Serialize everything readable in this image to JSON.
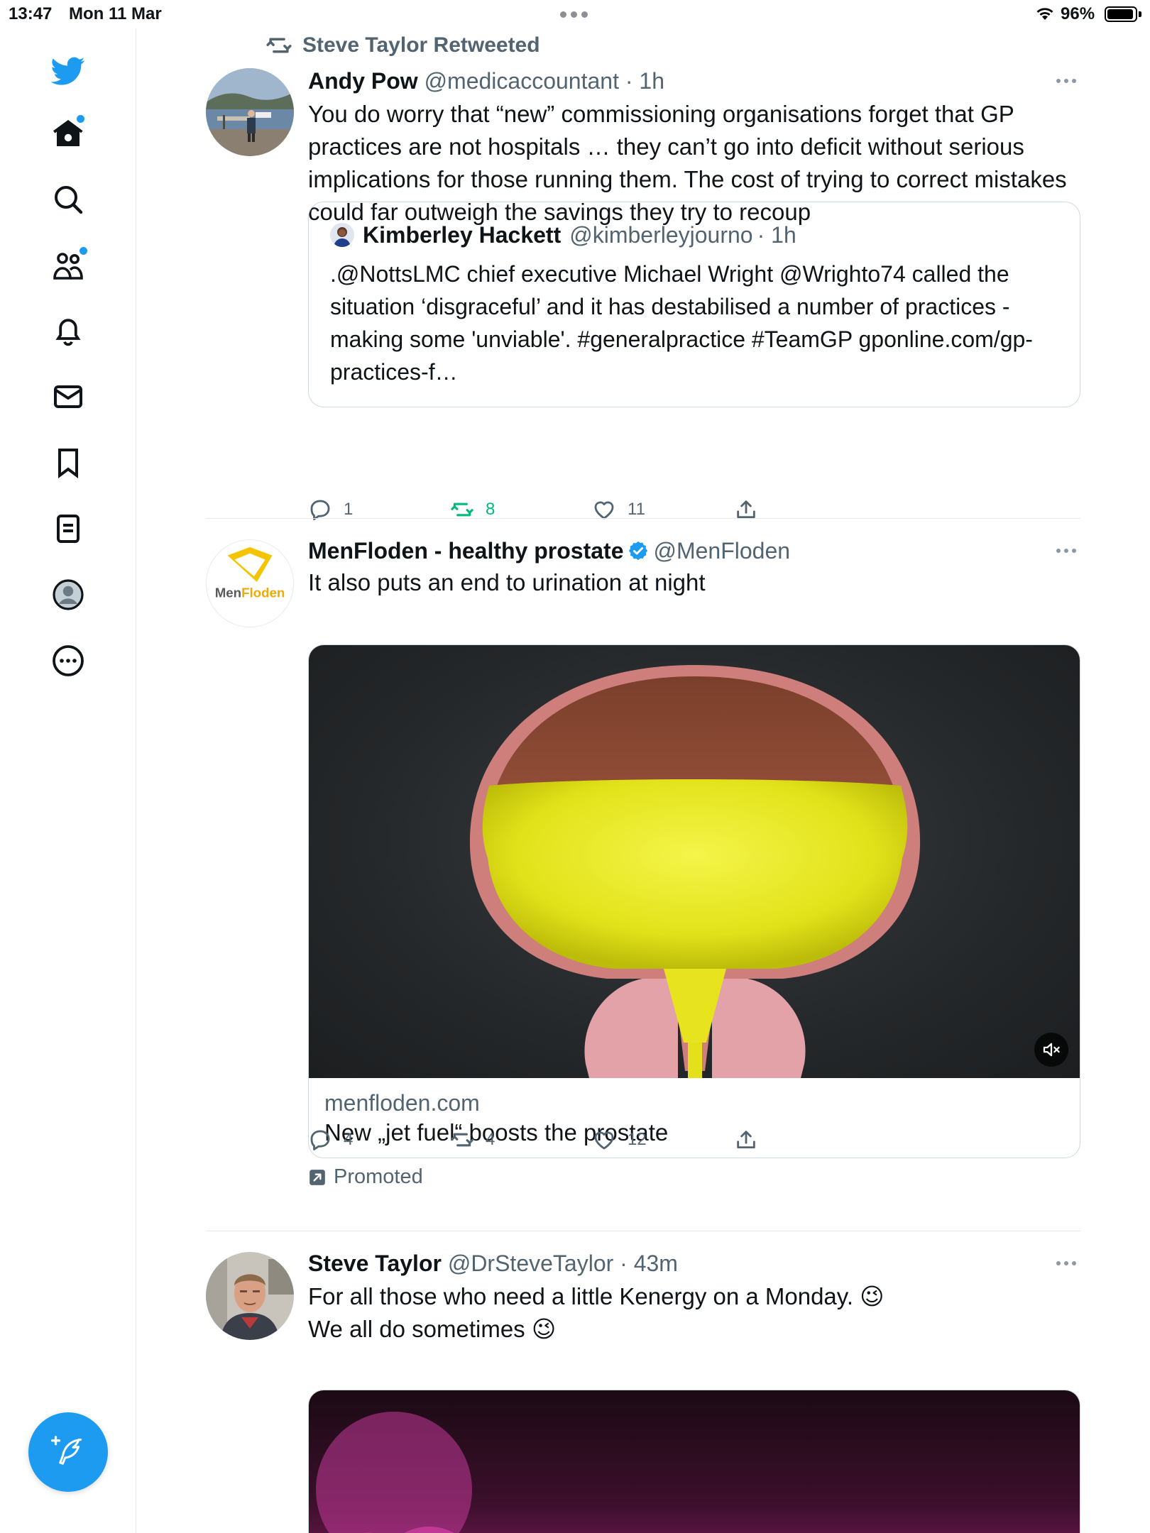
{
  "status_bar": {
    "time": "13:47",
    "date": "Mon 11 Mar",
    "battery_percent": "96%",
    "battery_level": 0.96
  },
  "sidebar": {
    "items": [
      {
        "name": "twitter-logo-icon"
      },
      {
        "name": "home-icon",
        "has_dot": true
      },
      {
        "name": "search-icon"
      },
      {
        "name": "communities-icon",
        "has_dot": true
      },
      {
        "name": "notifications-icon"
      },
      {
        "name": "messages-icon"
      },
      {
        "name": "bookmarks-icon"
      },
      {
        "name": "lists-icon"
      },
      {
        "name": "profile-icon"
      },
      {
        "name": "more-icon"
      }
    ],
    "compose_icon": "feather-plus-icon"
  },
  "tweets": [
    {
      "social_context": "Steve Taylor Retweeted",
      "name": "Andy Pow",
      "handle": "@medicaccountant",
      "time": "· 1h",
      "text": "You do worry that “new” commissioning organisations forget that GP practices are not hospitals … they can’t go into deficit without serious implications for those running them. The cost of trying to correct mistakes could far outweigh the savings they try to recoup",
      "quote": {
        "name": "Kimberley Hackett",
        "handle": "@kimberleyjourno",
        "time": "· 1h",
        "text": ".@NottsLMC chief executive Michael Wright @Wrighto74 called the situation ‘disgraceful’ and it has destabilised a number of practices - making some 'unviable'. #generalpractice #TeamGP gponline.com/gp-practices-f…"
      },
      "replies": "1",
      "retweets": "8",
      "likes": "11"
    },
    {
      "name": "MenFloden - healthy prostate",
      "verified": true,
      "handle": "@MenFloden",
      "text": "It also puts an end to urination at night",
      "avatar_logo_text_a": "Men",
      "avatar_logo_text_b": "Floden",
      "card_domain": "menfloden.com",
      "card_title": "New „jet fuel“ boosts the prostate",
      "replies": "4",
      "retweets": "4",
      "likes": "12",
      "promoted_label": "Promoted"
    },
    {
      "name": "Steve Taylor",
      "handle": "@DrSteveTaylor",
      "time": "· 43m",
      "text_line1": "For all those who need a little Kenergy on a Monday. 😉",
      "text_line2": "We all do sometimes 😉"
    }
  ],
  "colors": {
    "brand": "#1d9bf0",
    "retweet_active": "#00ba7c",
    "secondary_text": "#536471",
    "primary_text": "#0f1419",
    "border": "#cfd9de"
  }
}
